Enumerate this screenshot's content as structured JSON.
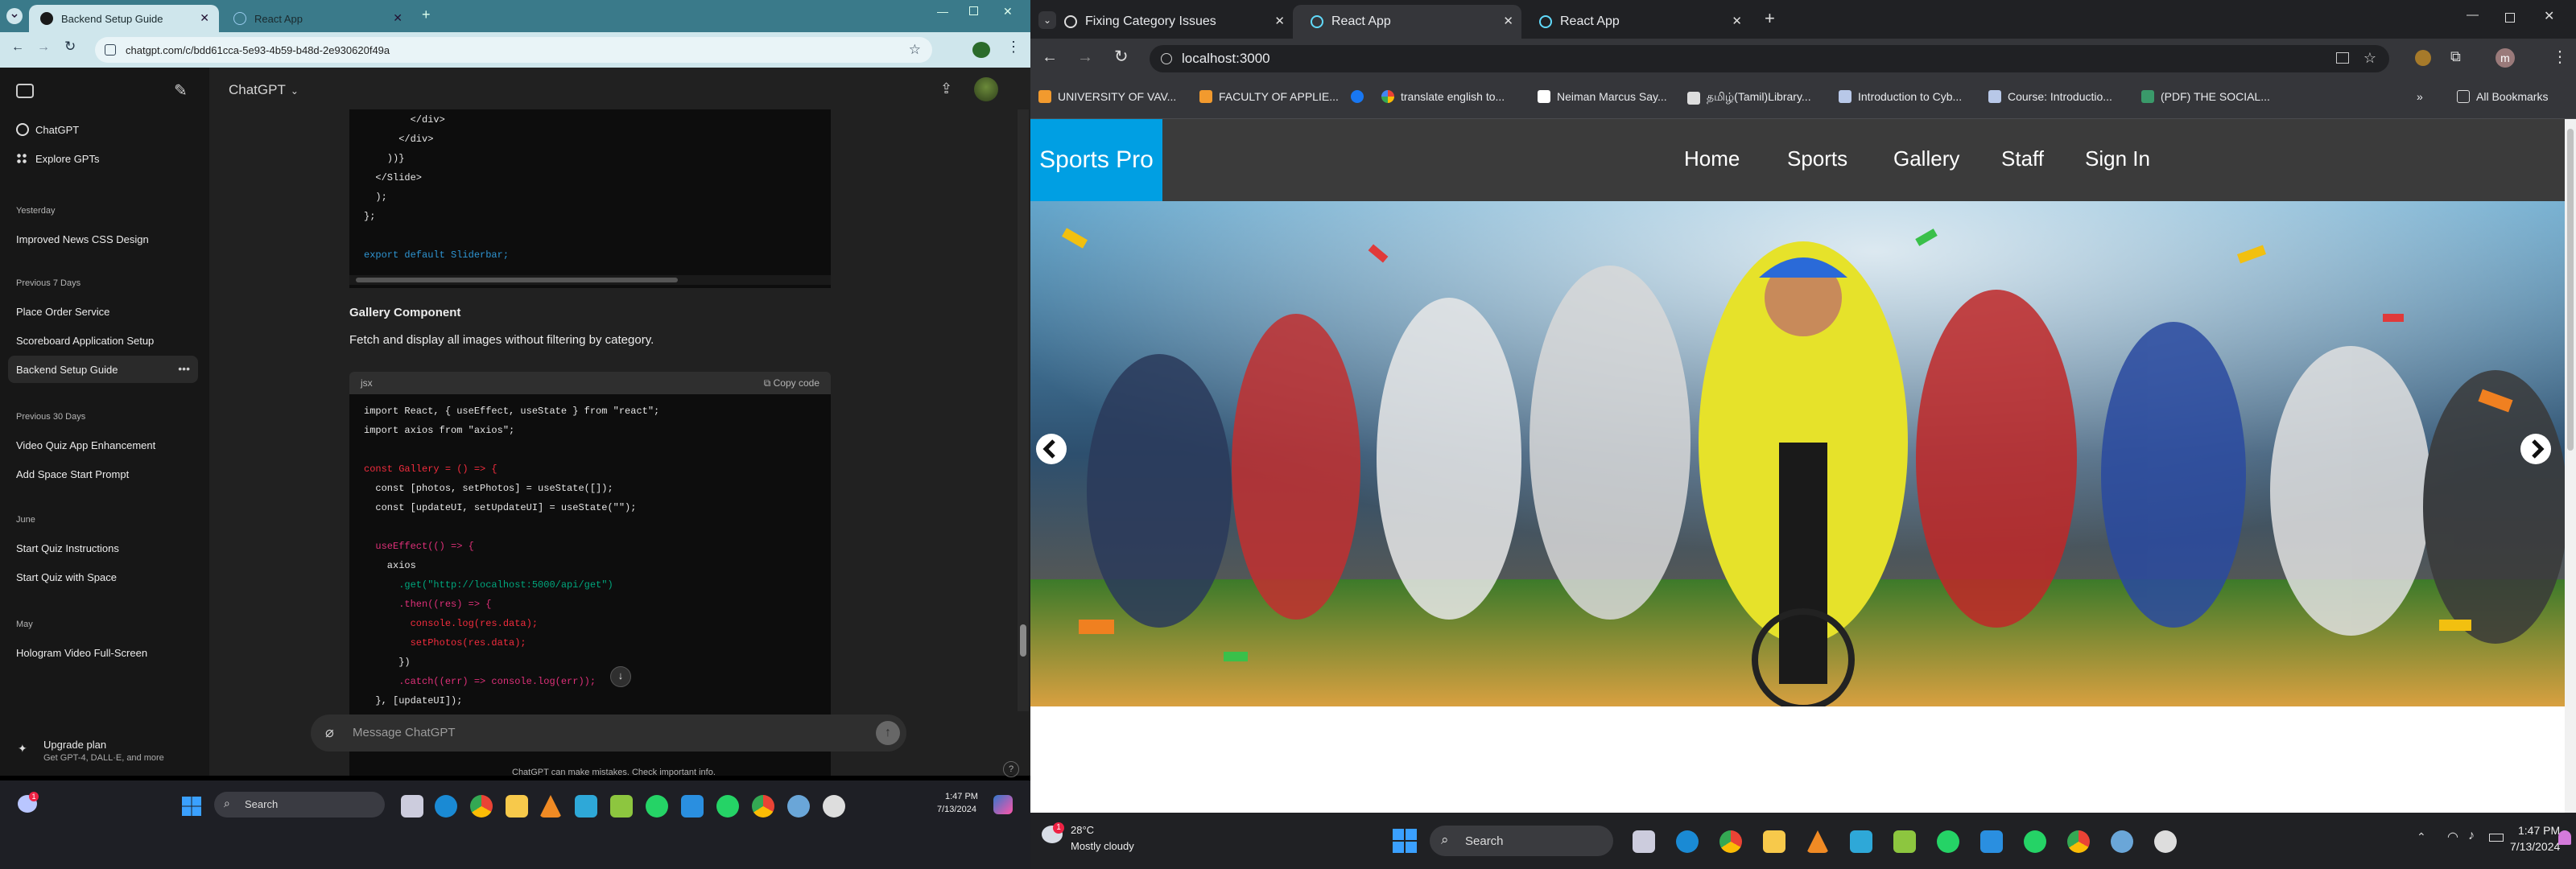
{
  "left_browser": {
    "tabs": [
      {
        "title": "Backend Setup Guide",
        "active": true
      },
      {
        "title": "React App",
        "active": false
      }
    ],
    "url": "chatgpt.com/c/bdd61cca-5e93-4b59-b48d-2e930620f49a",
    "chatgpt": {
      "model": "ChatGPT",
      "sidebar": {
        "top_items": [
          "ChatGPT",
          "Explore GPTs"
        ],
        "sections": [
          {
            "label": "Yesterday",
            "items": [
              "Improved News CSS Design"
            ]
          },
          {
            "label": "Previous 7 Days",
            "items": [
              "Place Order Service",
              "Scoreboard Application Setup",
              "Backend Setup Guide"
            ]
          },
          {
            "label": "Previous 30 Days",
            "items": [
              "Video Quiz App Enhancement",
              "Add Space Start Prompt"
            ]
          },
          {
            "label": "June",
            "items": [
              "Start Quiz Instructions",
              "Start Quiz with Space"
            ]
          },
          {
            "label": "May",
            "items": [
              "Hologram Video Full-Screen"
            ]
          }
        ],
        "upgrade_title": "Upgrade plan",
        "upgrade_sub": "Get GPT-4, DALL·E, and more"
      },
      "code_block_1": [
        "        </div>",
        "      </div>",
        "    ))}",
        "  </Slide>",
        "  );",
        "};",
        "",
        "export default Sliderbar;"
      ],
      "section_heading": "Gallery Component",
      "section_text": "Fetch and display all images without filtering by category.",
      "code_lang": "jsx",
      "copy_label": "Copy code",
      "code_block_2": [
        "import React, { useEffect, useState } from \"react\";",
        "import axios from \"axios\";",
        "",
        "const Gallery = () => {",
        "  const [photos, setPhotos] = useState([]);",
        "  const [updateUI, setUpdateUI] = useState(\"\");",
        "",
        "  useEffect(() => {",
        "    axios",
        "      .get(\"http://localhost:5000/api/get\")",
        "      .then((res) => {",
        "        console.log(res.data);",
        "        setPhotos(res.data);",
        "      })",
        "      .catch((err) => console.log(err));",
        "  }, [updateUI]);"
      ],
      "input_placeholder": "Message ChatGPT",
      "disclaimer": "ChatGPT can make mistakes. Check important info."
    },
    "taskbar": {
      "search": "Search",
      "time": "1:47 PM",
      "date": "7/13/2024",
      "notif_badge": "1"
    }
  },
  "right_browser": {
    "tabs": [
      {
        "title": "Fixing Category Issues",
        "active": false
      },
      {
        "title": "React App",
        "active": true
      },
      {
        "title": "React App",
        "active": false
      }
    ],
    "url": "localhost:3000",
    "bookmarks": [
      "UNIVERSITY OF VAV...",
      "FACULTY OF APPLIE...",
      "translate english to...",
      "Neiman Marcus Say...",
      "தமிழ்(Tamil)Library...",
      "Introduction to Cyb...",
      "Course: Introductio...",
      "(PDF) THE SOCIAL..."
    ],
    "all_bookmarks": "All Bookmarks",
    "profile_initial": "m",
    "site": {
      "brand": "Sports Pro",
      "nav": [
        "Home",
        "Sports",
        "Gallery",
        "Staff",
        "Sign In"
      ]
    },
    "taskbar": {
      "temp": "28°C",
      "weather": "Mostly cloudy",
      "weather_badge": "1",
      "search": "Search",
      "time": "1:47 PM",
      "date": "7/13/2024"
    }
  }
}
